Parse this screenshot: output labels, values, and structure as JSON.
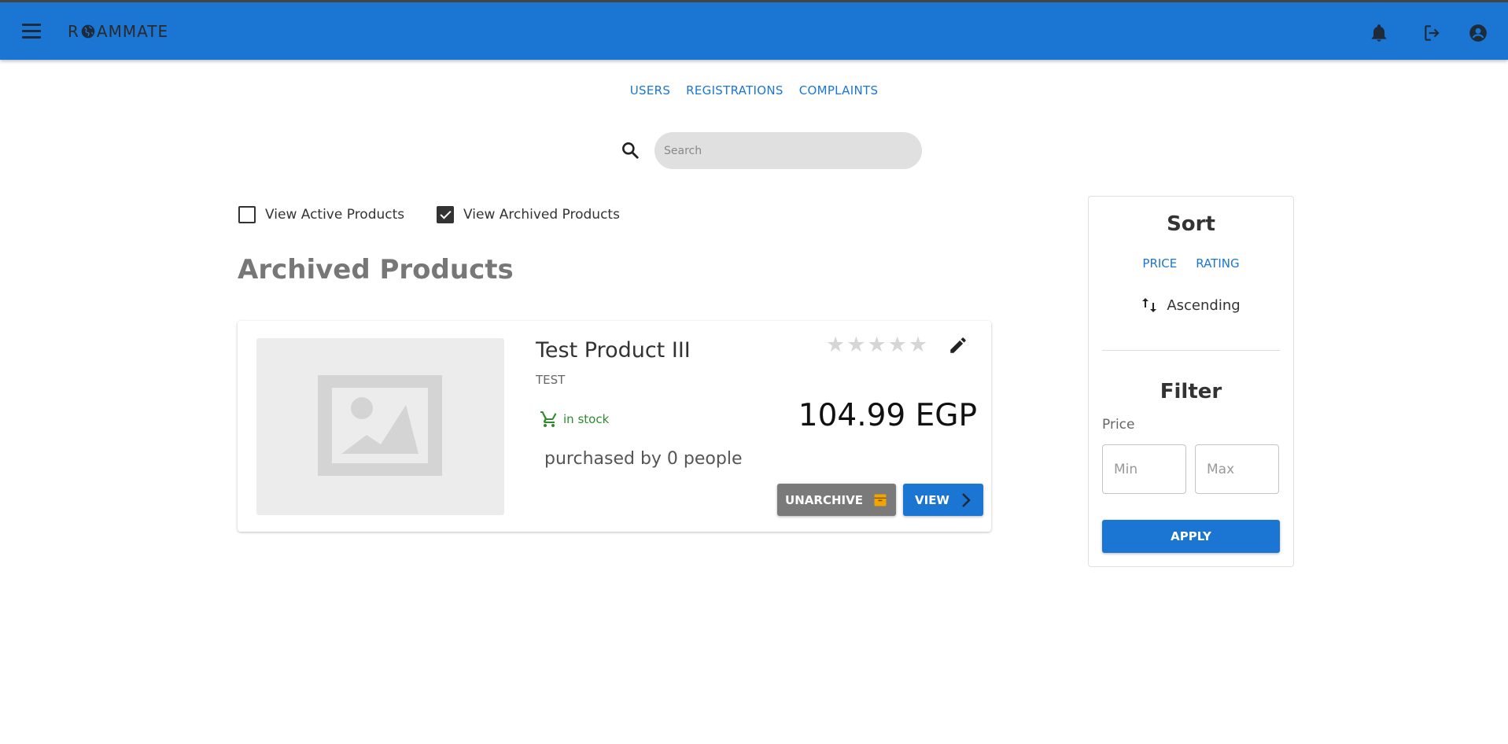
{
  "header": {
    "logo_left": "R",
    "logo_right": "AMMATE",
    "icons": [
      "menu-icon",
      "bell-icon",
      "logout-icon",
      "account-icon"
    ]
  },
  "nav": {
    "users": "USERS",
    "registrations": "REGISTRATIONS",
    "complaints": "COMPLAINTS"
  },
  "search": {
    "placeholder": "Search"
  },
  "filters": {
    "active_label": "View Active Products",
    "active_checked": false,
    "archived_label": "View Archived Products",
    "archived_checked": true
  },
  "section_title": "Archived Products",
  "product": {
    "name": "Test Product III",
    "category": "TEST",
    "stock": "in stock",
    "purchased": "purchased by 0 people",
    "price": "104.99 EGP",
    "rating": 0,
    "rating_max": 5,
    "unarchive_label": "UNARCHIVE",
    "view_label": "VIEW"
  },
  "sidebar": {
    "sort_title": "Sort",
    "sort_price": "PRICE",
    "sort_rating": "RATING",
    "order": "Ascending",
    "filter_title": "Filter",
    "price_label": "Price",
    "min_placeholder": "Min",
    "max_placeholder": "Max",
    "apply_label": "APPLY"
  },
  "colors": {
    "primary": "#1b76d3",
    "stock_green": "#2e8b2e",
    "unarchive_gray": "#7a7a7a",
    "archive_icon": "#f0a500"
  }
}
